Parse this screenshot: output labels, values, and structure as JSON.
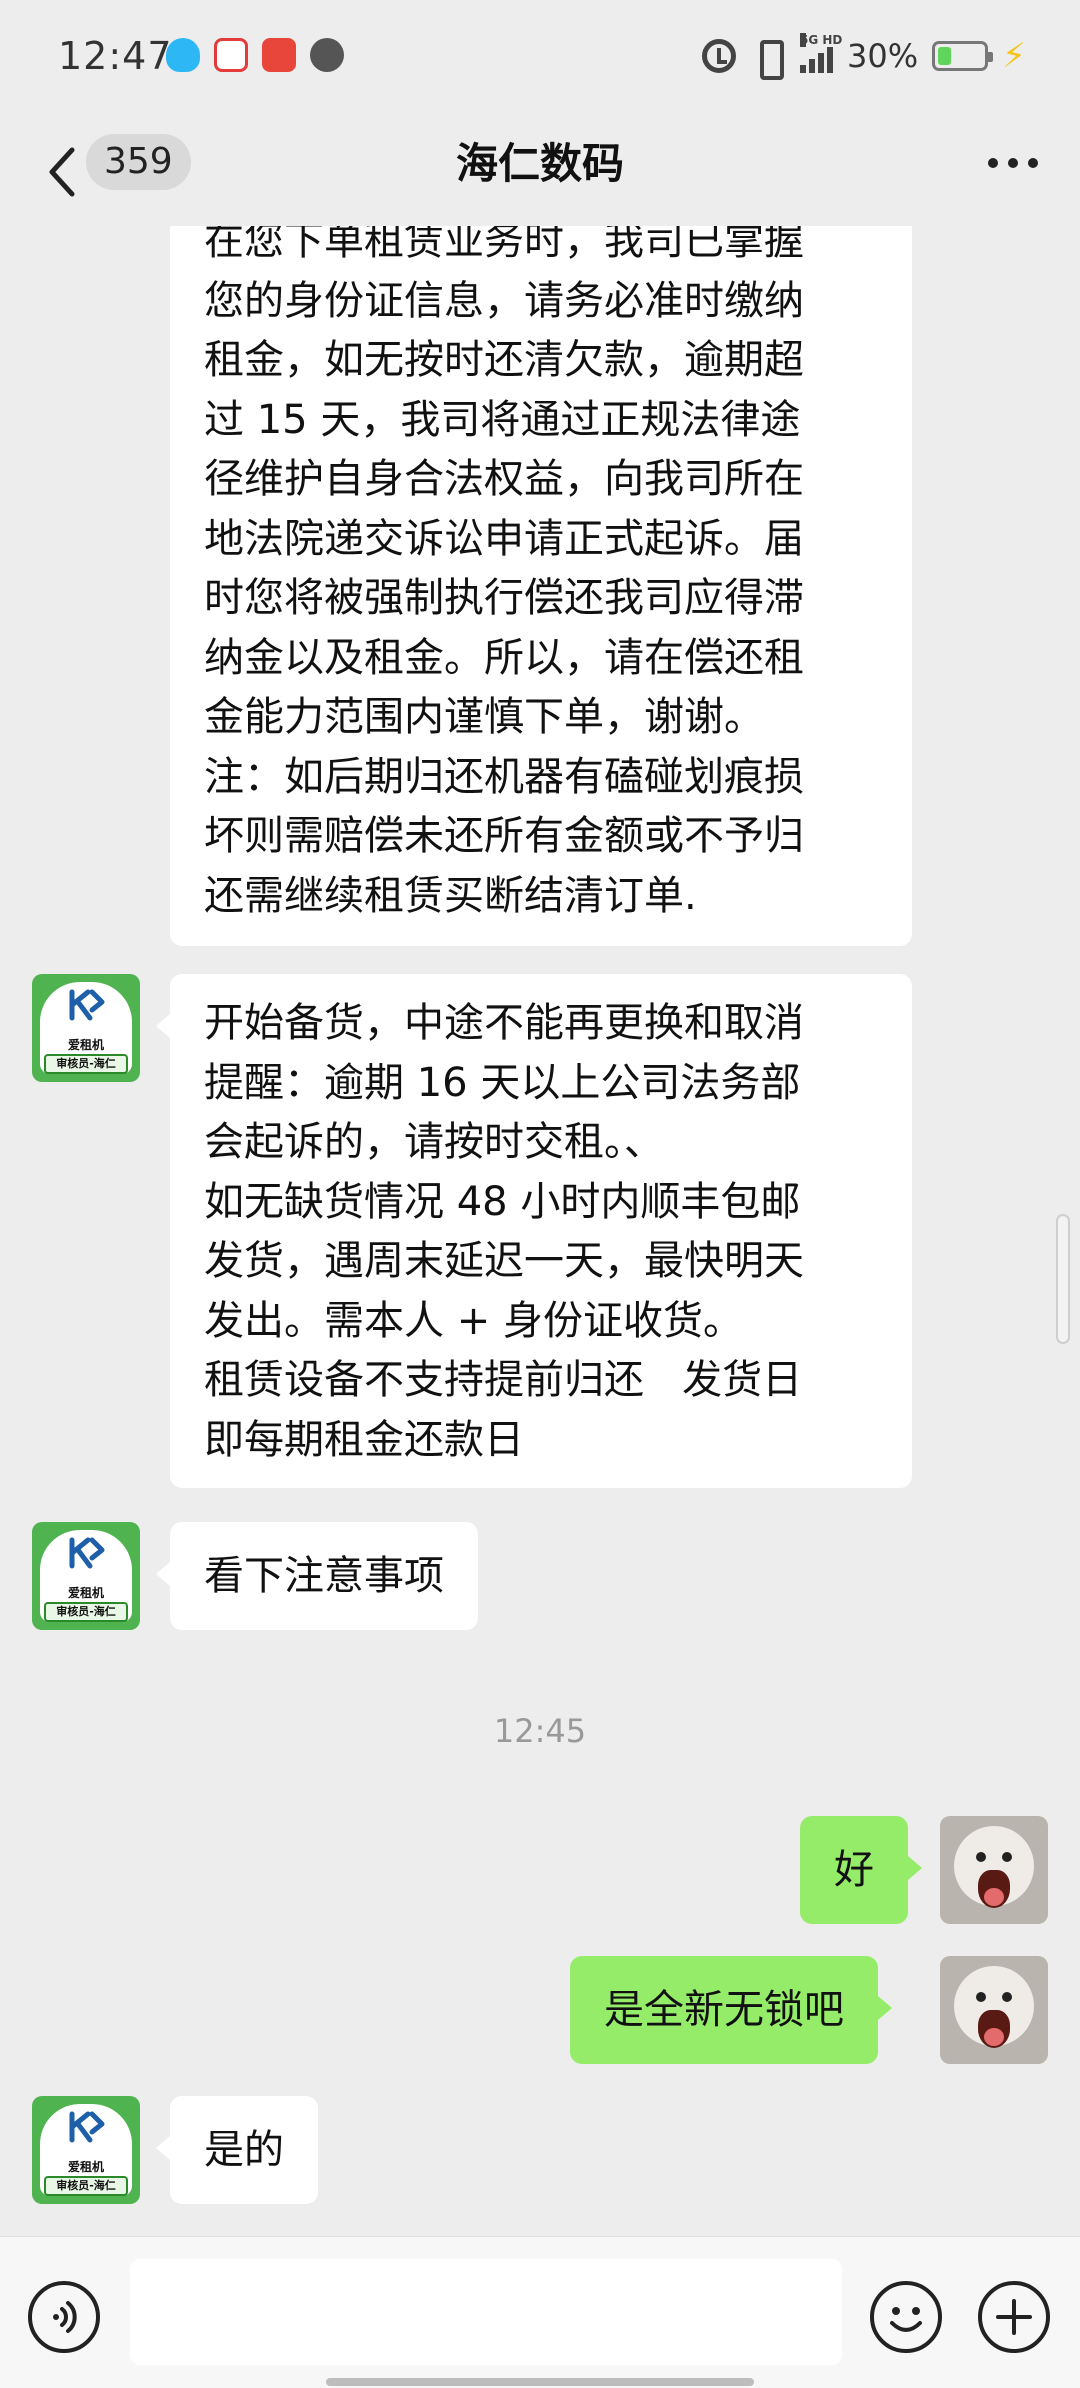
{
  "status_bar": {
    "time": "12:47",
    "network": "5G HD",
    "battery": "30%",
    "battery_level": 0.3
  },
  "header": {
    "unread_count": "359",
    "title": "海仁数码"
  },
  "avatar_shop": {
    "line1": "爱租机",
    "line2": "审核员-海仁"
  },
  "messages": [
    {
      "sender": "shop",
      "text": "在您下单租赁业务时，我司已掌握\n您的身份证信息，请务必准时缴纳\n租金，如无按时还清欠款，逾期超\n过 15 天，我司将通过正规法律途\n径维护自身合法权益，向我司所在\n地法院递交诉讼申请正式起诉。届\n时您将被强制执行偿还我司应得滞\n纳金以及租金。所以，请在偿还租\n金能力范围内谨慎下单，谢谢。\n注：如后期归还机器有磕碰划痕损\n坏则需赔偿未还所有金额或不予归\n还需继续租赁买断结清订单."
    },
    {
      "sender": "shop",
      "text": "开始备货，中途不能再更换和取消\n提醒：逾期 16 天以上公司法务部\n会起诉的，请按时交租。、\n如无缺货情况 48 小时内顺丰包邮\n发货，遇周末延迟一天，最快明天\n发出。需本人 + 身份证收货。\n租赁设备不支持提前归还   发货日\n即每期租金还款日"
    },
    {
      "sender": "shop",
      "text": "看下注意事项"
    },
    {
      "sender": "system",
      "text": "12:45"
    },
    {
      "sender": "me",
      "text": "好"
    },
    {
      "sender": "me",
      "text": "是全新无锁吧"
    },
    {
      "sender": "shop",
      "text": "是的"
    }
  ],
  "input": {
    "placeholder": ""
  }
}
